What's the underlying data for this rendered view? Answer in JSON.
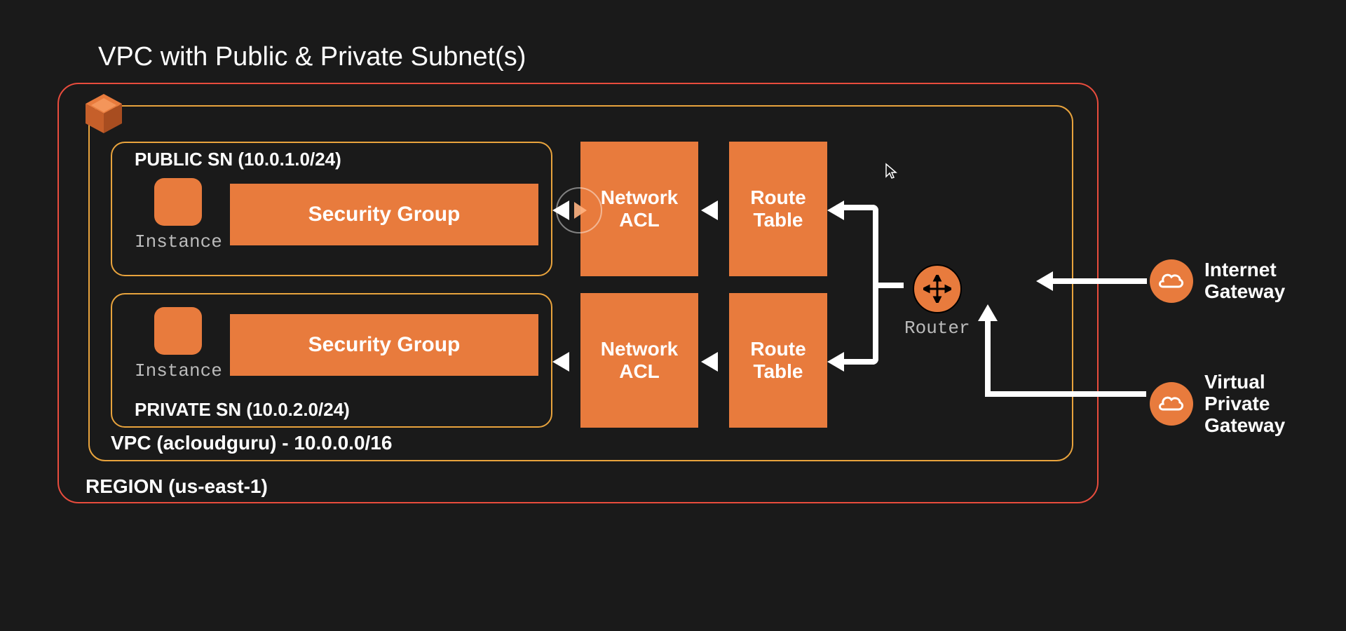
{
  "title": "VPC with Public & Private Subnet(s)",
  "region": {
    "label": "REGION (us-east-1)"
  },
  "vpc": {
    "label": "VPC (acloudguru) - 10.0.0.0/16",
    "icon": "vpc-cube-icon"
  },
  "subnets": {
    "public": {
      "label": "PUBLIC SN (10.0.1.0/24)",
      "instance_label": "Instance",
      "sg_label": "Security Group"
    },
    "private": {
      "label": "PRIVATE SN (10.0.2.0/24)",
      "instance_label": "Instance",
      "sg_label": "Security Group"
    }
  },
  "blocks": {
    "nacl_public": "Network\nACL",
    "nacl_private": "Network\nACL",
    "route_public": "Route\nTable",
    "route_private": "Route\nTable"
  },
  "router": {
    "label": "Router",
    "icon": "router-arrows-icon"
  },
  "gateways": {
    "igw": {
      "label": "Internet Gateway",
      "icon": "cloud-icon"
    },
    "vpg": {
      "label": "Virtual Private Gateway",
      "icon": "cloud-icon"
    }
  },
  "colors": {
    "orange": "#E87B3D",
    "region_border": "#E84C3D",
    "vpc_border": "#E8A33D",
    "bg": "#1a1a1a"
  }
}
